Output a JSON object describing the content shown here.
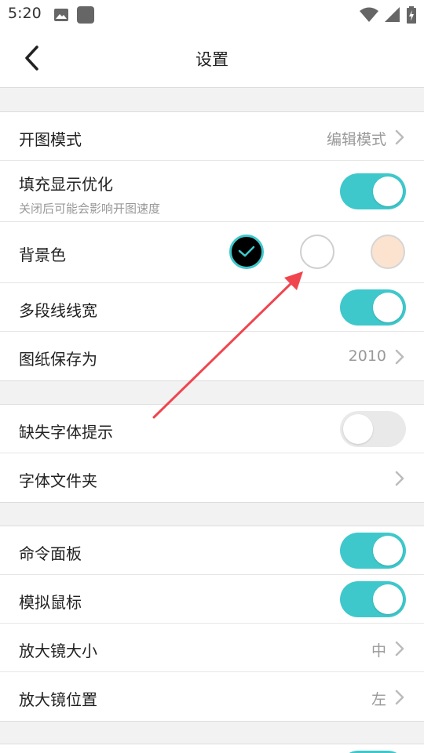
{
  "status_bar": {
    "time": "5:20",
    "left_icons": [
      "image-icon",
      "square-app-icon"
    ],
    "right_icons": [
      "wifi-icon",
      "signal-icon",
      "battery-charging-icon"
    ]
  },
  "header": {
    "title": "设置",
    "back_icon": "chevron-left-icon"
  },
  "groups": [
    {
      "rows": [
        {
          "label": "开图模式",
          "value": "编辑模式",
          "control": "chevron"
        },
        {
          "label": "填充显示优化",
          "sublabel": "关闭后可能会影响开图速度",
          "control": "toggle",
          "on": true
        },
        {
          "label": "背景色",
          "control": "color-swatches",
          "options": [
            "#000000",
            "#ffffff",
            "#fbe3cf"
          ],
          "selected": 0
        },
        {
          "label": "多段线线宽",
          "control": "toggle",
          "on": true
        },
        {
          "label": "图纸保存为",
          "value": "2010",
          "control": "chevron"
        }
      ]
    },
    {
      "rows": [
        {
          "label": "缺失字体提示",
          "control": "toggle",
          "on": false
        },
        {
          "label": "字体文件夹",
          "control": "chevron"
        }
      ]
    },
    {
      "rows": [
        {
          "label": "命令面板",
          "control": "toggle",
          "on": true
        },
        {
          "label": "模拟鼠标",
          "control": "toggle",
          "on": true
        },
        {
          "label": "放大镜大小",
          "value": "中",
          "control": "chevron"
        },
        {
          "label": "放大镜位置",
          "value": "左",
          "control": "chevron"
        }
      ]
    }
  ],
  "colors": {
    "accent": "#3ec8cb",
    "annotation": "#f0454f"
  }
}
